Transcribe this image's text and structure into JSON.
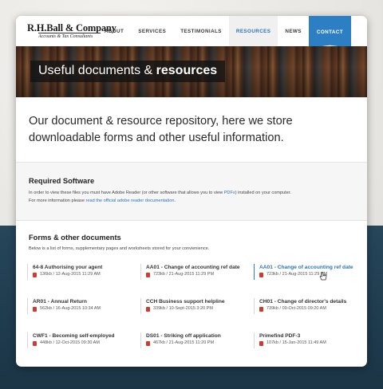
{
  "logo": {
    "name": "R.H.Ball & Company",
    "subtitle": "Accounts & Tax Consultants"
  },
  "nav": {
    "items": [
      {
        "label": "ABOUT"
      },
      {
        "label": "SERVICES"
      },
      {
        "label": "TESTIMONIALS"
      },
      {
        "label": "RESOURCES"
      },
      {
        "label": "NEWS"
      },
      {
        "label": "CONTACT"
      }
    ]
  },
  "hero": {
    "title_light": "Useful documents &",
    "title_bold": "resources"
  },
  "intro": {
    "text": "Our document & resource repository, here we store downloadable forms and other useful information."
  },
  "software": {
    "title": "Required Software",
    "line1_pre": "In order to view these files you must have Adobe Reader (or other software that allows you to view ",
    "line1_link": "PDFs",
    "line1_post": ") installed on your computer.",
    "line2_pre": "For more information please ",
    "line2_link": "read the official adobe reader documentation",
    "line2_post": "."
  },
  "documents": {
    "title": "Forms & other documents",
    "description": "Below is a list of forms, supplementary pages and worksheets stored for your convienience.",
    "items": [
      {
        "title": "64-8 Authorising your agent",
        "meta": "136kb / 12-Aug-2015 11:29 AM"
      },
      {
        "title": "AA01 - Change of accounting ref date",
        "meta": "723kb / 21-Aug-2015 11:29 PM"
      },
      {
        "title": "AA01 - Change of accounting ref date",
        "meta": "723kb / 21-Aug-2015 11:29 PM"
      },
      {
        "title": "AR01 - Annual Return",
        "meta": "562kb / 16-Aug-2015 10:34 AM"
      },
      {
        "title": "CCH Business support helpline",
        "meta": "339kb / 10-Sept-2015 3:20 PM"
      },
      {
        "title": "CH01 - Change of director's details",
        "meta": "739kb / 09-Oct-2015 09:20 AM"
      },
      {
        "title": "CWF1 - Becoming self-employed",
        "meta": "448kb / 12-Oct-2015 09:30 AM"
      },
      {
        "title": "DS01 - Striking off application",
        "meta": "467kb / 21-Aug-2015 11:20 PM"
      },
      {
        "title": "Primefind PDF-3",
        "meta": "107kb / 15-Jan-2015 11:49 AM"
      }
    ]
  },
  "colors": {
    "accent": "#2d7fc4",
    "link": "#2b74b8",
    "pdf_icon": "#d33a2f",
    "dark_bg": "#1f3b4e"
  },
  "icons": {
    "pdf": "pdf-icon",
    "cursor": "pointer-hand-icon"
  }
}
